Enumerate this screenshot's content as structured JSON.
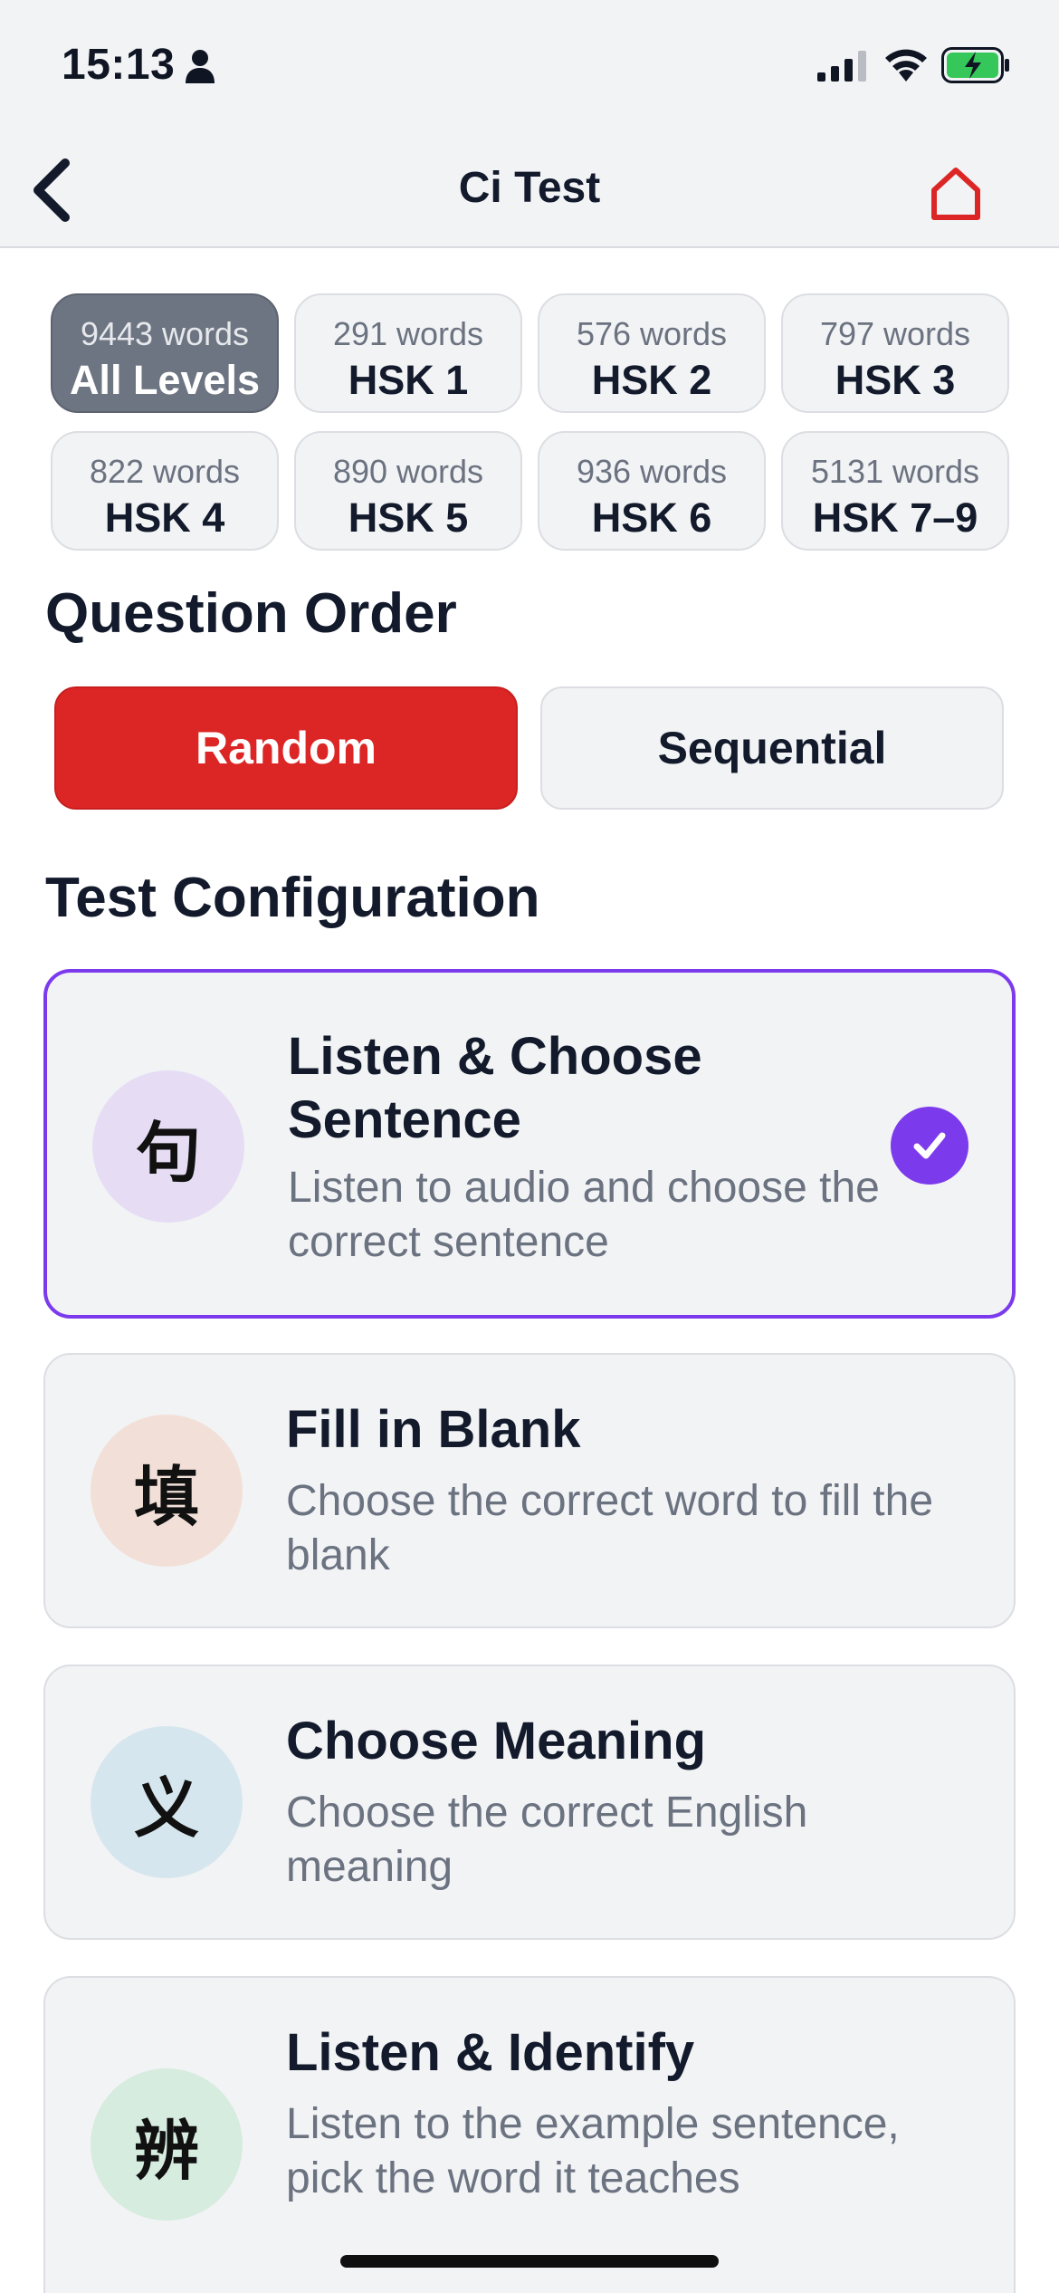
{
  "status_bar": {
    "time": "15:13"
  },
  "nav": {
    "title": "Ci Test"
  },
  "levels": [
    {
      "count": "9443 words",
      "label": "All Levels",
      "selected": true
    },
    {
      "count": "291 words",
      "label": "HSK 1"
    },
    {
      "count": "576 words",
      "label": "HSK 2"
    },
    {
      "count": "797 words",
      "label": "HSK 3"
    },
    {
      "count": "822 words",
      "label": "HSK 4"
    },
    {
      "count": "890 words",
      "label": "HSK 5"
    },
    {
      "count": "936 words",
      "label": "HSK 6"
    },
    {
      "count": "5131 words",
      "label": "HSK 7–9"
    }
  ],
  "question_order": {
    "title": "Question Order",
    "options": [
      "Random",
      "Sequential"
    ],
    "selected": "Random"
  },
  "test_config": {
    "title": "Test Configuration",
    "cards": [
      {
        "icon": "句",
        "title": "Listen & Choose Sentence",
        "desc": "Listen to audio and choose the correct sentence",
        "selected": true
      },
      {
        "icon": "填",
        "title": "Fill in Blank",
        "desc": "Choose the correct word to fill the blank"
      },
      {
        "icon": "义",
        "title": "Choose Meaning",
        "desc": "Choose the correct English meaning"
      },
      {
        "icon": "辨",
        "title": "Listen & Identify",
        "desc": "Listen to the example sentence, pick the word it teaches"
      }
    ]
  },
  "colors": {
    "accent_red": "#dc2626",
    "accent_purple": "#7c3aed",
    "icon_bg_purple": "#e6ddf5",
    "icon_bg_peach": "#f2e0d8",
    "icon_bg_blue": "#d6e6ee",
    "icon_bg_green": "#d6ecdf"
  },
  "icons": [
    "back-chevron-icon",
    "home-icon",
    "person-icon",
    "signal-icon",
    "wifi-icon",
    "battery-charging-icon",
    "checkmark-icon"
  ]
}
